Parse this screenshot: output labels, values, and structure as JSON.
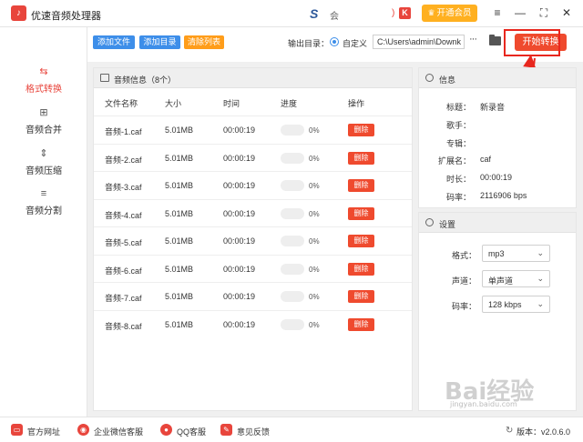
{
  "app": {
    "title": "优速音频处理器",
    "logo_glyph": "♪",
    "ad_text": "会",
    "paren": ")",
    "k_badge": "K",
    "vip_label": "开通会员"
  },
  "window_controls": {
    "menu": "≡",
    "minimize": "—",
    "maximize": "⛶",
    "close": "✕"
  },
  "sidebar": {
    "items": [
      {
        "label": "格式转换",
        "icon": "convert-icon",
        "glyph": "⇆",
        "active": true
      },
      {
        "label": "音频合并",
        "icon": "merge-icon",
        "glyph": "⊞",
        "active": false
      },
      {
        "label": "音频压缩",
        "icon": "compress-icon",
        "glyph": "⇕",
        "active": false
      },
      {
        "label": "音频分割",
        "icon": "split-icon",
        "glyph": "≡",
        "active": false
      }
    ]
  },
  "toolbar": {
    "add_file": "添加文件",
    "add_dir": "添加目录",
    "clear_list": "清除列表",
    "output_label": "输出目录：",
    "radio_label": "自定义",
    "path_value": "C:\\Users\\admin\\Downk",
    "more": "···",
    "start_label": "开始转换"
  },
  "file_list": {
    "header_title": "音频信息（8个）",
    "columns": [
      "文件名称",
      "大小",
      "时间",
      "进度",
      "操作"
    ],
    "rows": [
      {
        "name": "音频-1.caf",
        "size": "5.01MB",
        "time": "00:00:19",
        "progress": 0,
        "pct": "0%",
        "action": "删除"
      },
      {
        "name": "音频-2.caf",
        "size": "5.01MB",
        "time": "00:00:19",
        "progress": 0,
        "pct": "0%",
        "action": "删除"
      },
      {
        "name": "音频-3.caf",
        "size": "5.01MB",
        "time": "00:00:19",
        "progress": 0,
        "pct": "0%",
        "action": "删除"
      },
      {
        "name": "音频-4.caf",
        "size": "5.01MB",
        "time": "00:00:19",
        "progress": 0,
        "pct": "0%",
        "action": "删除"
      },
      {
        "name": "音频-5.caf",
        "size": "5.01MB",
        "time": "00:00:19",
        "progress": 0,
        "pct": "0%",
        "action": "删除"
      },
      {
        "name": "音频-6.caf",
        "size": "5.01MB",
        "time": "00:00:19",
        "progress": 0,
        "pct": "0%",
        "action": "删除"
      },
      {
        "name": "音频-7.caf",
        "size": "5.01MB",
        "time": "00:00:19",
        "progress": 0,
        "pct": "0%",
        "action": "删除"
      },
      {
        "name": "音频-8.caf",
        "size": "5.01MB",
        "time": "00:00:19",
        "progress": 0,
        "pct": "0%",
        "action": "删除"
      }
    ]
  },
  "info": {
    "header_title": "信息",
    "fields": [
      {
        "key": "标题：",
        "value": "新录音"
      },
      {
        "key": "歌手：",
        "value": ""
      },
      {
        "key": "专辑：",
        "value": ""
      },
      {
        "key": "扩展名：",
        "value": "caf"
      },
      {
        "key": "时长：",
        "value": "00:00:19"
      },
      {
        "key": "码率：",
        "value": "2116906 bps"
      }
    ]
  },
  "settings": {
    "header_title": "设置",
    "fields": [
      {
        "key": "格式：",
        "value": "mp3"
      },
      {
        "key": "声道：",
        "value": "单声道"
      },
      {
        "key": "码率：",
        "value": "128 kbps"
      }
    ]
  },
  "footer": {
    "items": [
      {
        "label": "官方网址",
        "icon": "website-icon"
      },
      {
        "label": "企业微信客服",
        "icon": "wechat-service-icon"
      },
      {
        "label": "QQ客服",
        "icon": "qq-icon"
      },
      {
        "label": "意见反馈",
        "icon": "feedback-icon"
      }
    ],
    "version": "版本：v2.0.6.0"
  },
  "watermark": {
    "text": "Bai经验",
    "sub": "jingyan.baidu.com"
  },
  "colors": {
    "accent_red": "#ef4a2e",
    "accent_blue": "#3d8ee9",
    "accent_orange": "#ff9d1a",
    "vip_gold": "#ffb020",
    "annotation_red": "#e8271e"
  }
}
